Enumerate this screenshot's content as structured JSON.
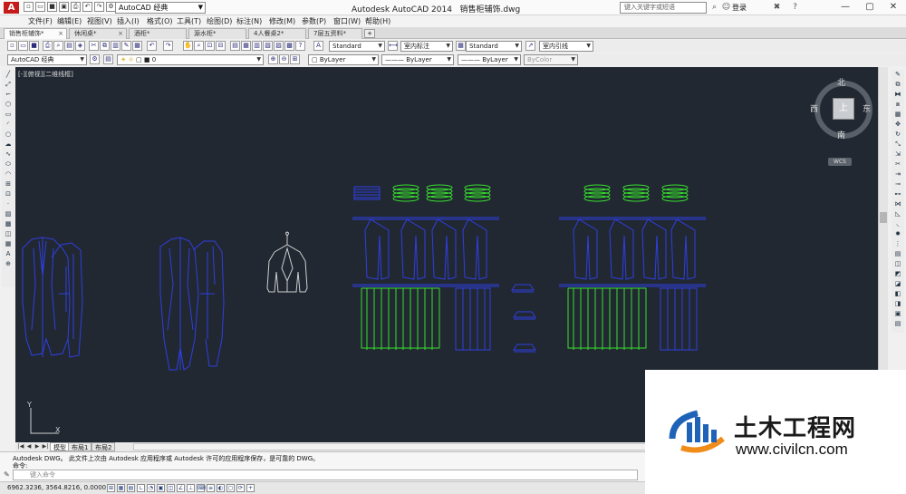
{
  "window": {
    "title": "Autodesk AutoCAD 2014",
    "file_name": "销售柜辅饰.dwg",
    "app_logo": "A",
    "workspace": "AutoCAD 经典",
    "help_search_placeholder": "键入关键字或短语",
    "login_label": "登录"
  },
  "menu": [
    "文件(F)",
    "编辑(E)",
    "视图(V)",
    "插入(I)",
    "格式(O)",
    "工具(T)",
    "绘图(D)",
    "标注(N)",
    "修改(M)",
    "参数(P)",
    "窗口(W)",
    "帮助(H)"
  ],
  "tabs": [
    {
      "label": "销售柜辅饰*",
      "active": true
    },
    {
      "label": "休闲桌*",
      "active": false
    },
    {
      "label": "酒柜*",
      "active": false
    },
    {
      "label": "源水柜*",
      "active": false
    },
    {
      "label": "4人餐桌2*",
      "active": false
    },
    {
      "label": "7层五资料*",
      "active": false
    }
  ],
  "styles_toolbar": {
    "text_style": "Standard",
    "dim_style": "室内标注",
    "table_style": "Standard",
    "mleader_style": "室内引线"
  },
  "layers_toolbar": {
    "workspace": "AutoCAD 经典",
    "layer": "0",
    "color": "ByLayer",
    "linetype": "ByLayer",
    "lineweight": "ByLayer",
    "plot_style": "ByColor"
  },
  "canvas": {
    "viewport_label": "[-][俯视][二维线框]",
    "viewcube": {
      "top": "上",
      "north": "北",
      "south": "南",
      "east": "东",
      "west": "西",
      "wcs": "WCS"
    },
    "ucs": {
      "y": "Y",
      "x": "X"
    }
  },
  "layout_tabs": [
    "模型",
    "布局1",
    "布局2"
  ],
  "command": {
    "history_line1": "Autodesk DWG。 此文件上次由 Autodesk 应用程序或 Autodesk 许可的应用程序保存，是可靠的 DWG。",
    "history_line2": "命令:",
    "input_placeholder": "键入命令"
  },
  "status": {
    "coordinates": "6962.3236,  3564.8216, 0.0000"
  },
  "watermark": {
    "title": "土木工程网",
    "url": "www.civilcn.com"
  },
  "colors": {
    "canvas_bg": "#212832",
    "blue_lines": "#2f3fe0",
    "green_lines": "#37e02c",
    "white_lines": "#cfcfcf"
  }
}
